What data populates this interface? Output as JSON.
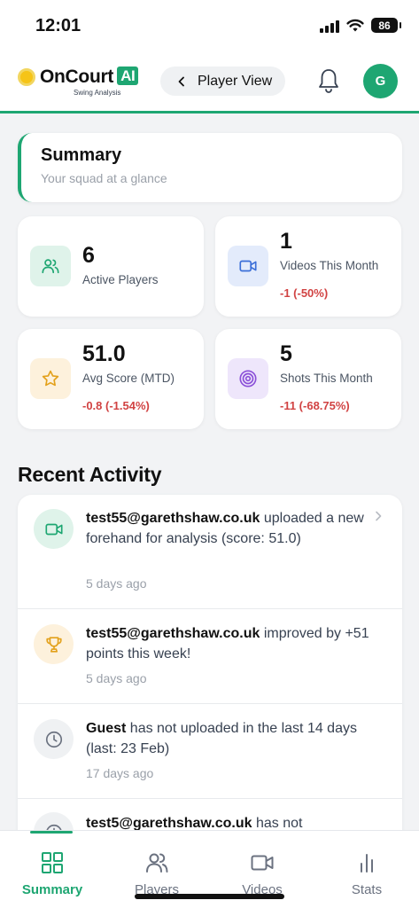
{
  "status_bar": {
    "time": "12:01",
    "battery": "86"
  },
  "header": {
    "logo_name": "OnCourt",
    "logo_badge": "AI",
    "logo_tagline": "Swing Analysis",
    "view_toggle_label": "Player View",
    "avatar_initial": "G"
  },
  "summary": {
    "title": "Summary",
    "subtitle": "Your squad at a glance"
  },
  "stats": [
    {
      "value": "6",
      "label": "Active Players",
      "delta": "",
      "icon": "users-icon"
    },
    {
      "value": "1",
      "label": "Videos This Month",
      "delta": "-1 (-50%)",
      "icon": "video-icon"
    },
    {
      "value": "51.0",
      "label": "Avg Score (MTD)",
      "delta": "-0.8 (-1.54%)",
      "icon": "star-icon"
    },
    {
      "value": "5",
      "label": "Shots This Month",
      "delta": "-11 (-68.75%)",
      "icon": "target-icon"
    }
  ],
  "recent_activity": {
    "title": "Recent Activity",
    "items": [
      {
        "actor": "test55@garethshaw.co.uk",
        "text": " uploaded a new forehand for analysis (score: 51.0)",
        "time": "5 days ago",
        "icon": "video-icon"
      },
      {
        "actor": "test55@garethshaw.co.uk",
        "text": " improved by +51 points this week!",
        "time": "5 days ago",
        "icon": "trophy-icon"
      },
      {
        "actor": "Guest",
        "text": " has not uploaded in the last 14 days (last: 23 Feb)",
        "time": "17 days ago",
        "icon": "clock-icon"
      },
      {
        "actor": "test5@garethshaw.co.uk",
        "text": " has not",
        "time": "",
        "icon": "clock-icon"
      }
    ]
  },
  "bottom_nav": [
    {
      "label": "Summary",
      "active": true,
      "icon": "grid-icon"
    },
    {
      "label": "Players",
      "active": false,
      "icon": "users-icon"
    },
    {
      "label": "Videos",
      "active": false,
      "icon": "video-icon"
    },
    {
      "label": "Stats",
      "active": false,
      "icon": "bar-chart-icon"
    }
  ],
  "colors": {
    "accent": "#1ea672",
    "negative": "#d14343",
    "users_icon_bg": "#dff3ea",
    "video_icon_bg": "#e3ebfb",
    "star_icon_bg": "#fdf1dc",
    "target_icon_bg": "#eee6fb"
  }
}
